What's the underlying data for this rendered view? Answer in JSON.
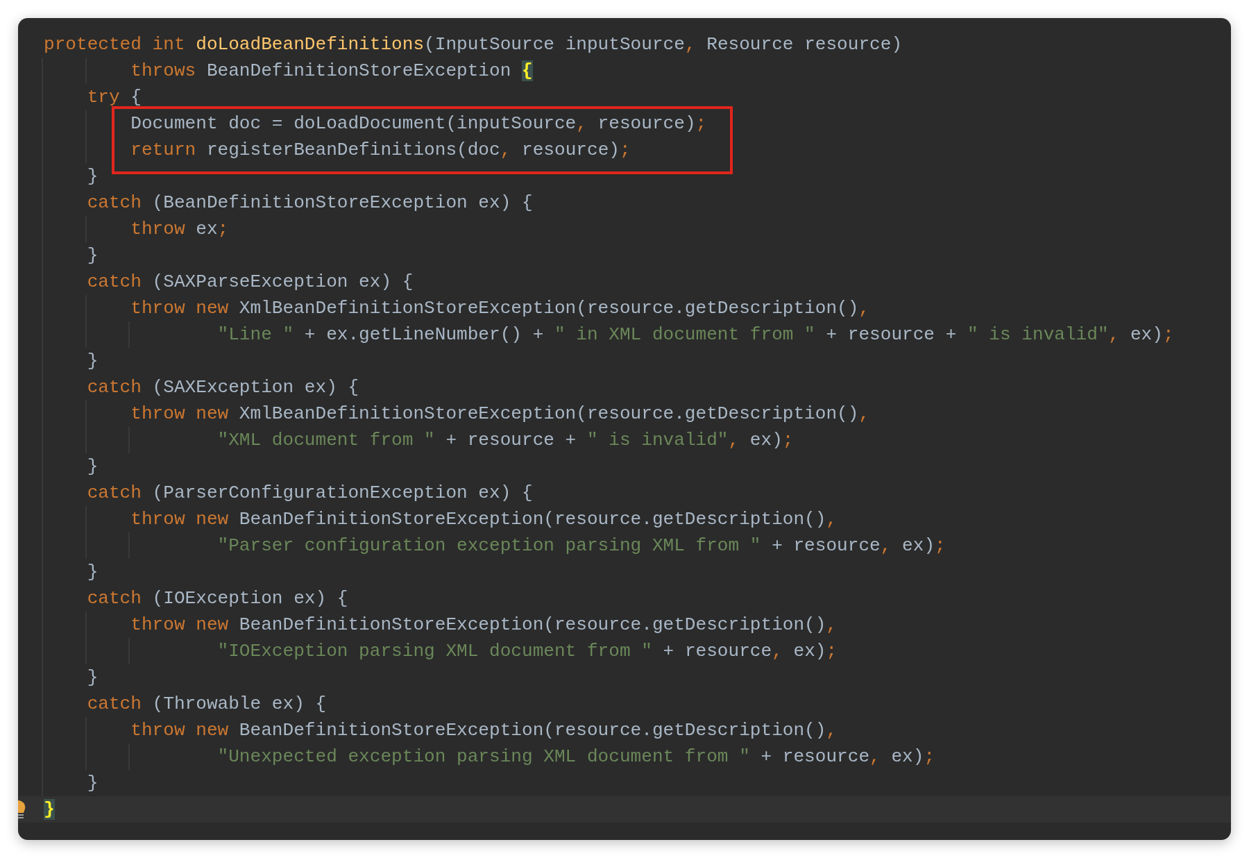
{
  "editor": {
    "lines": [
      {
        "boxed": false,
        "current": false,
        "tokens": [
          {
            "kind": "keyword",
            "text": "protected int "
          },
          {
            "kind": "function",
            "text": "doLoadBeanDefinitions"
          },
          {
            "kind": "plain",
            "text": "(InputSource inputSource"
          },
          {
            "kind": "punct",
            "text": ", "
          },
          {
            "kind": "plain",
            "text": "Resource resource)"
          }
        ]
      },
      {
        "boxed": false,
        "current": false,
        "tokens": [
          {
            "kind": "keyword",
            "text": "        throws "
          },
          {
            "kind": "plain",
            "text": "BeanDefinitionStoreException "
          },
          {
            "kind": "brace_match",
            "text": "{"
          }
        ]
      },
      {
        "boxed": false,
        "current": false,
        "tokens": [
          {
            "kind": "keyword",
            "text": "    try"
          },
          {
            "kind": "plain",
            "text": " {"
          }
        ]
      },
      {
        "boxed": true,
        "current": false,
        "tokens": [
          {
            "kind": "plain",
            "text": "        Document doc = doLoadDocument(inputSource"
          },
          {
            "kind": "punct",
            "text": ", "
          },
          {
            "kind": "plain",
            "text": "resource)"
          },
          {
            "kind": "punct",
            "text": ";"
          }
        ]
      },
      {
        "boxed": true,
        "current": false,
        "tokens": [
          {
            "kind": "keyword",
            "text": "        return "
          },
          {
            "kind": "plain",
            "text": "registerBeanDefinitions(doc"
          },
          {
            "kind": "punct",
            "text": ", "
          },
          {
            "kind": "plain",
            "text": "resource)"
          },
          {
            "kind": "punct",
            "text": ";"
          }
        ]
      },
      {
        "boxed": false,
        "current": false,
        "tokens": [
          {
            "kind": "plain",
            "text": "    }"
          }
        ]
      },
      {
        "boxed": false,
        "current": false,
        "tokens": [
          {
            "kind": "keyword",
            "text": "    catch "
          },
          {
            "kind": "plain",
            "text": "(BeanDefinitionStoreException ex) {"
          }
        ]
      },
      {
        "boxed": false,
        "current": false,
        "tokens": [
          {
            "kind": "keyword",
            "text": "        throw "
          },
          {
            "kind": "plain",
            "text": "ex"
          },
          {
            "kind": "punct",
            "text": ";"
          }
        ]
      },
      {
        "boxed": false,
        "current": false,
        "tokens": [
          {
            "kind": "plain",
            "text": "    }"
          }
        ]
      },
      {
        "boxed": false,
        "current": false,
        "tokens": [
          {
            "kind": "keyword",
            "text": "    catch "
          },
          {
            "kind": "plain",
            "text": "(SAXParseException ex) {"
          }
        ]
      },
      {
        "boxed": false,
        "current": false,
        "tokens": [
          {
            "kind": "keyword",
            "text": "        throw new "
          },
          {
            "kind": "plain",
            "text": "XmlBeanDefinitionStoreException(resource.getDescription()"
          },
          {
            "kind": "punct",
            "text": ","
          }
        ]
      },
      {
        "boxed": false,
        "current": false,
        "tokens": [
          {
            "kind": "string",
            "text": "                \"Line \""
          },
          {
            "kind": "plain",
            "text": " + ex.getLineNumber() + "
          },
          {
            "kind": "string",
            "text": "\" in XML document from \""
          },
          {
            "kind": "plain",
            "text": " + resource + "
          },
          {
            "kind": "string",
            "text": "\" is invalid\""
          },
          {
            "kind": "punct",
            "text": ", "
          },
          {
            "kind": "plain",
            "text": "ex)"
          },
          {
            "kind": "punct",
            "text": ";"
          }
        ]
      },
      {
        "boxed": false,
        "current": false,
        "tokens": [
          {
            "kind": "plain",
            "text": "    }"
          }
        ]
      },
      {
        "boxed": false,
        "current": false,
        "tokens": [
          {
            "kind": "keyword",
            "text": "    catch "
          },
          {
            "kind": "plain",
            "text": "(SAXException ex) {"
          }
        ]
      },
      {
        "boxed": false,
        "current": false,
        "tokens": [
          {
            "kind": "keyword",
            "text": "        throw new "
          },
          {
            "kind": "plain",
            "text": "XmlBeanDefinitionStoreException(resource.getDescription()"
          },
          {
            "kind": "punct",
            "text": ","
          }
        ]
      },
      {
        "boxed": false,
        "current": false,
        "tokens": [
          {
            "kind": "string",
            "text": "                \"XML document from \""
          },
          {
            "kind": "plain",
            "text": " + resource + "
          },
          {
            "kind": "string",
            "text": "\" is invalid\""
          },
          {
            "kind": "punct",
            "text": ", "
          },
          {
            "kind": "plain",
            "text": "ex)"
          },
          {
            "kind": "punct",
            "text": ";"
          }
        ]
      },
      {
        "boxed": false,
        "current": false,
        "tokens": [
          {
            "kind": "plain",
            "text": "    }"
          }
        ]
      },
      {
        "boxed": false,
        "current": false,
        "tokens": [
          {
            "kind": "keyword",
            "text": "    catch "
          },
          {
            "kind": "plain",
            "text": "(ParserConfigurationException ex) {"
          }
        ]
      },
      {
        "boxed": false,
        "current": false,
        "tokens": [
          {
            "kind": "keyword",
            "text": "        throw new "
          },
          {
            "kind": "plain",
            "text": "BeanDefinitionStoreException(resource.getDescription()"
          },
          {
            "kind": "punct",
            "text": ","
          }
        ]
      },
      {
        "boxed": false,
        "current": false,
        "tokens": [
          {
            "kind": "string",
            "text": "                \"Parser configuration exception parsing XML from \""
          },
          {
            "kind": "plain",
            "text": " + resource"
          },
          {
            "kind": "punct",
            "text": ", "
          },
          {
            "kind": "plain",
            "text": "ex)"
          },
          {
            "kind": "punct",
            "text": ";"
          }
        ]
      },
      {
        "boxed": false,
        "current": false,
        "tokens": [
          {
            "kind": "plain",
            "text": "    }"
          }
        ]
      },
      {
        "boxed": false,
        "current": false,
        "tokens": [
          {
            "kind": "keyword",
            "text": "    catch "
          },
          {
            "kind": "plain",
            "text": "(IOException ex) {"
          }
        ]
      },
      {
        "boxed": false,
        "current": false,
        "tokens": [
          {
            "kind": "keyword",
            "text": "        throw new "
          },
          {
            "kind": "plain",
            "text": "BeanDefinitionStoreException(resource.getDescription()"
          },
          {
            "kind": "punct",
            "text": ","
          }
        ]
      },
      {
        "boxed": false,
        "current": false,
        "tokens": [
          {
            "kind": "string",
            "text": "                \"IOException parsing XML document from \""
          },
          {
            "kind": "plain",
            "text": " + resource"
          },
          {
            "kind": "punct",
            "text": ", "
          },
          {
            "kind": "plain",
            "text": "ex)"
          },
          {
            "kind": "punct",
            "text": ";"
          }
        ]
      },
      {
        "boxed": false,
        "current": false,
        "tokens": [
          {
            "kind": "plain",
            "text": "    }"
          }
        ]
      },
      {
        "boxed": false,
        "current": false,
        "tokens": [
          {
            "kind": "keyword",
            "text": "    catch "
          },
          {
            "kind": "plain",
            "text": "(Throwable ex) {"
          }
        ]
      },
      {
        "boxed": false,
        "current": false,
        "tokens": [
          {
            "kind": "keyword",
            "text": "        throw new "
          },
          {
            "kind": "plain",
            "text": "BeanDefinitionStoreException(resource.getDescription()"
          },
          {
            "kind": "punct",
            "text": ","
          }
        ]
      },
      {
        "boxed": false,
        "current": false,
        "tokens": [
          {
            "kind": "string",
            "text": "                \"Unexpected exception parsing XML document from \""
          },
          {
            "kind": "plain",
            "text": " + resource"
          },
          {
            "kind": "punct",
            "text": ", "
          },
          {
            "kind": "plain",
            "text": "ex)"
          },
          {
            "kind": "punct",
            "text": ";"
          }
        ]
      },
      {
        "boxed": false,
        "current": false,
        "tokens": [
          {
            "kind": "plain",
            "text": "    }"
          }
        ]
      },
      {
        "boxed": false,
        "current": true,
        "tokens": [
          {
            "kind": "brace_match",
            "text": "}"
          }
        ]
      }
    ]
  }
}
